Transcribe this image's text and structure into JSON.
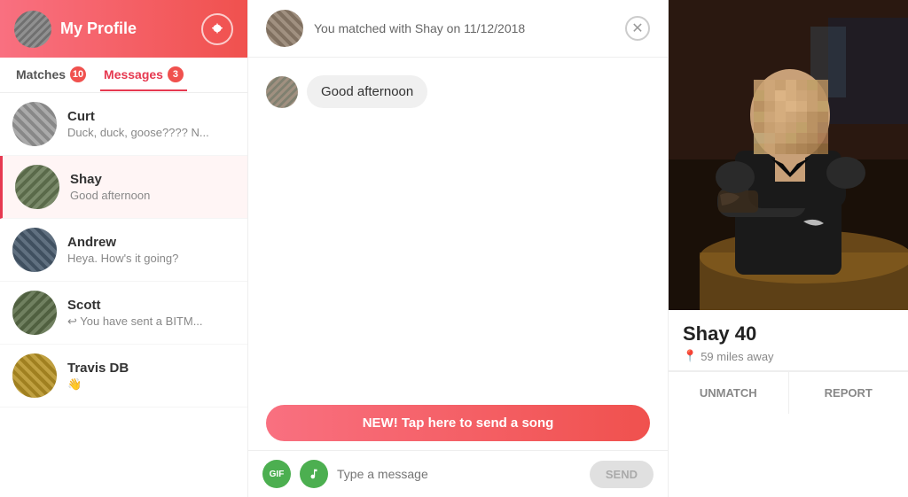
{
  "sidebar": {
    "header": {
      "title": "My Profile",
      "avatar_alt": "profile avatar"
    },
    "tabs": [
      {
        "id": "matches",
        "label": "Matches",
        "badge": "10",
        "active": false
      },
      {
        "id": "messages",
        "label": "Messages",
        "badge": "3",
        "active": true
      }
    ],
    "conversations": [
      {
        "id": "curt",
        "name": "Curt",
        "preview": "Duck, duck, goose???? N...",
        "active": false,
        "avatar_class": "av1"
      },
      {
        "id": "shay",
        "name": "Shay",
        "preview": "Good afternoon",
        "active": true,
        "avatar_class": "av2"
      },
      {
        "id": "andrew",
        "name": "Andrew",
        "preview": "Heya. How's it going?",
        "active": false,
        "avatar_class": "av3"
      },
      {
        "id": "scott",
        "name": "Scott",
        "preview": "↩ You have sent a BITM...",
        "active": false,
        "avatar_class": "av4"
      },
      {
        "id": "travis",
        "name": "Travis DB",
        "preview": "👋",
        "active": false,
        "avatar_class": "av5"
      }
    ]
  },
  "chat": {
    "match_text": "You matched with Shay on 11/12/2018",
    "messages": [
      {
        "id": 1,
        "text": "Good afternoon",
        "from": "match"
      }
    ],
    "song_banner": "NEW! Tap here to send a song",
    "input_placeholder": "Type a message",
    "send_label": "SEND",
    "gif_label": "GIF",
    "music_icon": "♪"
  },
  "profile": {
    "name": "Shay",
    "age": "40",
    "distance": "59 miles away",
    "unmatch_label": "UNMATCH",
    "report_label": "REPORT",
    "pin_icon": "📍"
  },
  "colors": {
    "brand_gradient_start": "#f97080",
    "brand_gradient_end": "#f0514e",
    "active_tab": "#e63950",
    "badge_bg": "#f0514e",
    "song_banner": "#f97080"
  }
}
